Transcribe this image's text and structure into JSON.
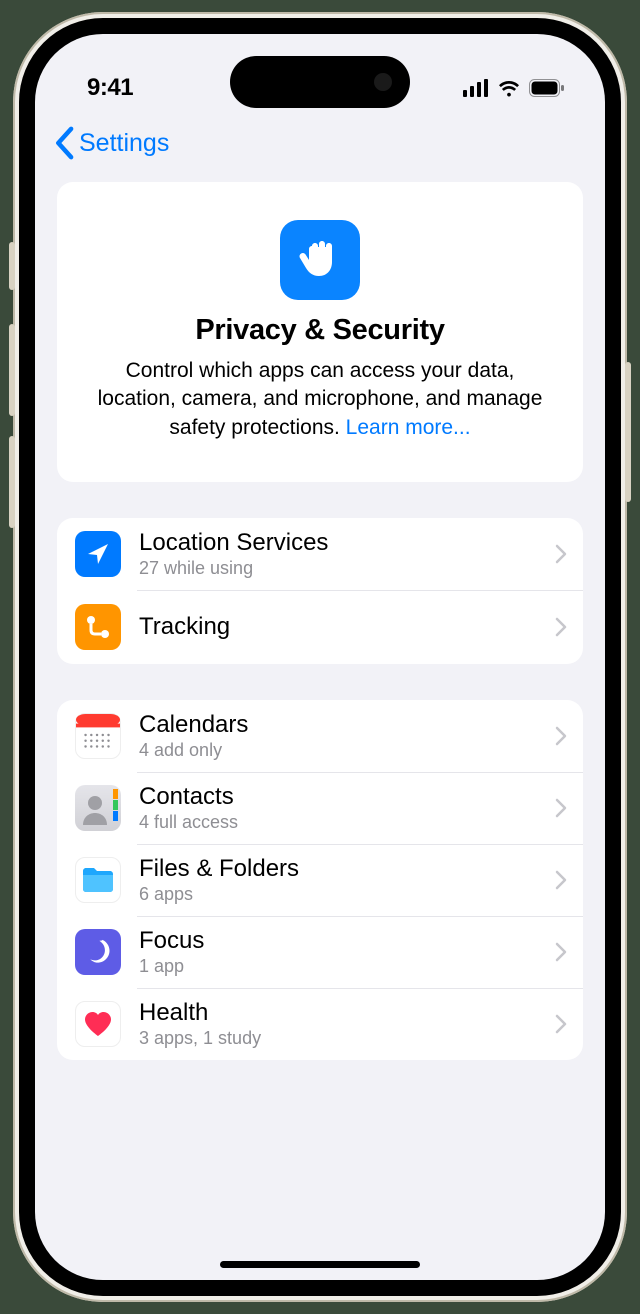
{
  "status": {
    "time": "9:41"
  },
  "nav": {
    "back_label": "Settings"
  },
  "header": {
    "title": "Privacy & Security",
    "description": "Control which apps can access your data, location, camera, and microphone, and manage safety protections. ",
    "learn_more": "Learn more..."
  },
  "group1": {
    "items": [
      {
        "title": "Location Services",
        "sub": "27 while using"
      },
      {
        "title": "Tracking",
        "sub": ""
      }
    ]
  },
  "group2": {
    "items": [
      {
        "title": "Calendars",
        "sub": "4 add only"
      },
      {
        "title": "Contacts",
        "sub": "4 full access"
      },
      {
        "title": "Files & Folders",
        "sub": "6 apps"
      },
      {
        "title": "Focus",
        "sub": "1 app"
      },
      {
        "title": "Health",
        "sub": "3 apps, 1 study"
      }
    ]
  }
}
